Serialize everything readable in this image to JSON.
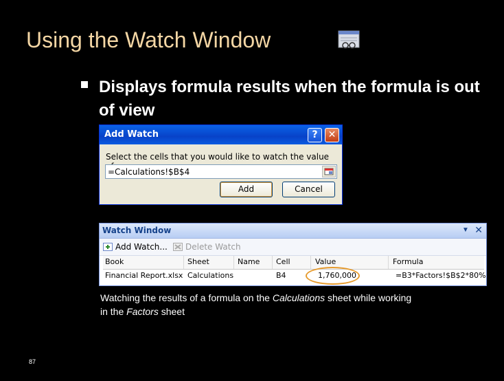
{
  "slide": {
    "title": "Using the Watch Window",
    "title_icon": "watch-window-icon",
    "bullet": "Displays formula results when the formula is out of view",
    "page_number": "87"
  },
  "add_watch_dialog": {
    "title": "Add Watch",
    "help_label": "?",
    "close_label": "✕",
    "prompt": "Select the cells that you would like to watch the value of:",
    "reference_value": "=Calculations!$B$4",
    "add_label": "Add",
    "cancel_label": "Cancel",
    "colors": {
      "titlebar": "#0842c8",
      "body": "#ece9d8"
    }
  },
  "watch_window": {
    "title": "Watch Window",
    "close_label": "✕",
    "add_watch_label": "Add Watch...",
    "delete_watch_label": "Delete Watch",
    "columns": [
      "Book",
      "Sheet",
      "Name",
      "Cell",
      "Value",
      "Formula"
    ],
    "rows": [
      {
        "book": "Financial Report.xlsx",
        "sheet": "Calculations",
        "name": "",
        "cell": "B4",
        "value": "1,760,000",
        "formula": "=B3*Factors!$B$2*80%"
      }
    ],
    "highlight_color": "#e69b2e"
  },
  "caption": {
    "text1": "Watching the results of a formula on the ",
    "em1": "Calculations",
    "text2": " sheet while working in the ",
    "em2": "Factors",
    "text3": " sheet"
  }
}
